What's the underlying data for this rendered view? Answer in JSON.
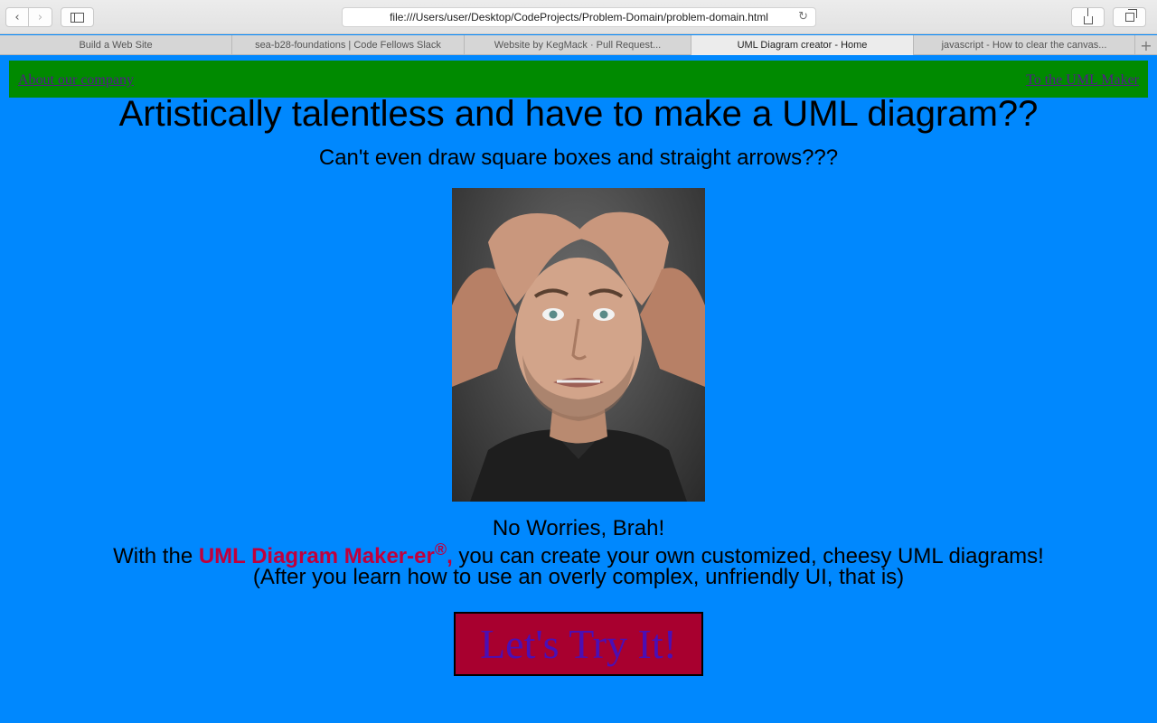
{
  "browser": {
    "url": "file:///Users/user/Desktop/CodeProjects/Problem-Domain/problem-domain.html",
    "tabs": [
      {
        "label": "Build a Web Site",
        "active": false
      },
      {
        "label": "sea-b28-foundations | Code Fellows Slack",
        "active": false
      },
      {
        "label": "Website by KegMack · Pull Request...",
        "active": false
      },
      {
        "label": "UML Diagram creator - Home",
        "active": true
      },
      {
        "label": "javascript - How to clear the canvas...",
        "active": false
      }
    ],
    "icons": {
      "back": "chevron-left-icon",
      "forward": "chevron-right-icon",
      "sidebar": "sidebar-icon",
      "reload": "reload-icon",
      "share": "share-icon",
      "tabs": "tab-overview-icon",
      "new_tab": "plus-icon"
    }
  },
  "page": {
    "nav": {
      "left_link": "About our company",
      "right_link": "To the UML Maker"
    },
    "headline": "Artistically talentless and have to make a UML diagram??",
    "subhead": "Can't even draw square boxes and straight arrows???",
    "photo": "stressed-man-photo",
    "worries": "No Worries, Brah!",
    "pitch": {
      "prefix": "With the ",
      "brand": "UML Diagram Maker-er",
      "reg": "®",
      "comma": ",",
      "suffix": " you can create your own customized, cheesy UML diagrams!"
    },
    "caveat": "(After you learn how to use an overly complex, unfriendly UI, that is)",
    "cta_label": "Let's Try It!",
    "colors": {
      "page_background": "#0088fe",
      "nav_background": "#008a00",
      "link": "#551a8b",
      "brand": "#c0003c",
      "cta_background": "#a8002f",
      "cta_text": "#4b0fb4"
    }
  }
}
